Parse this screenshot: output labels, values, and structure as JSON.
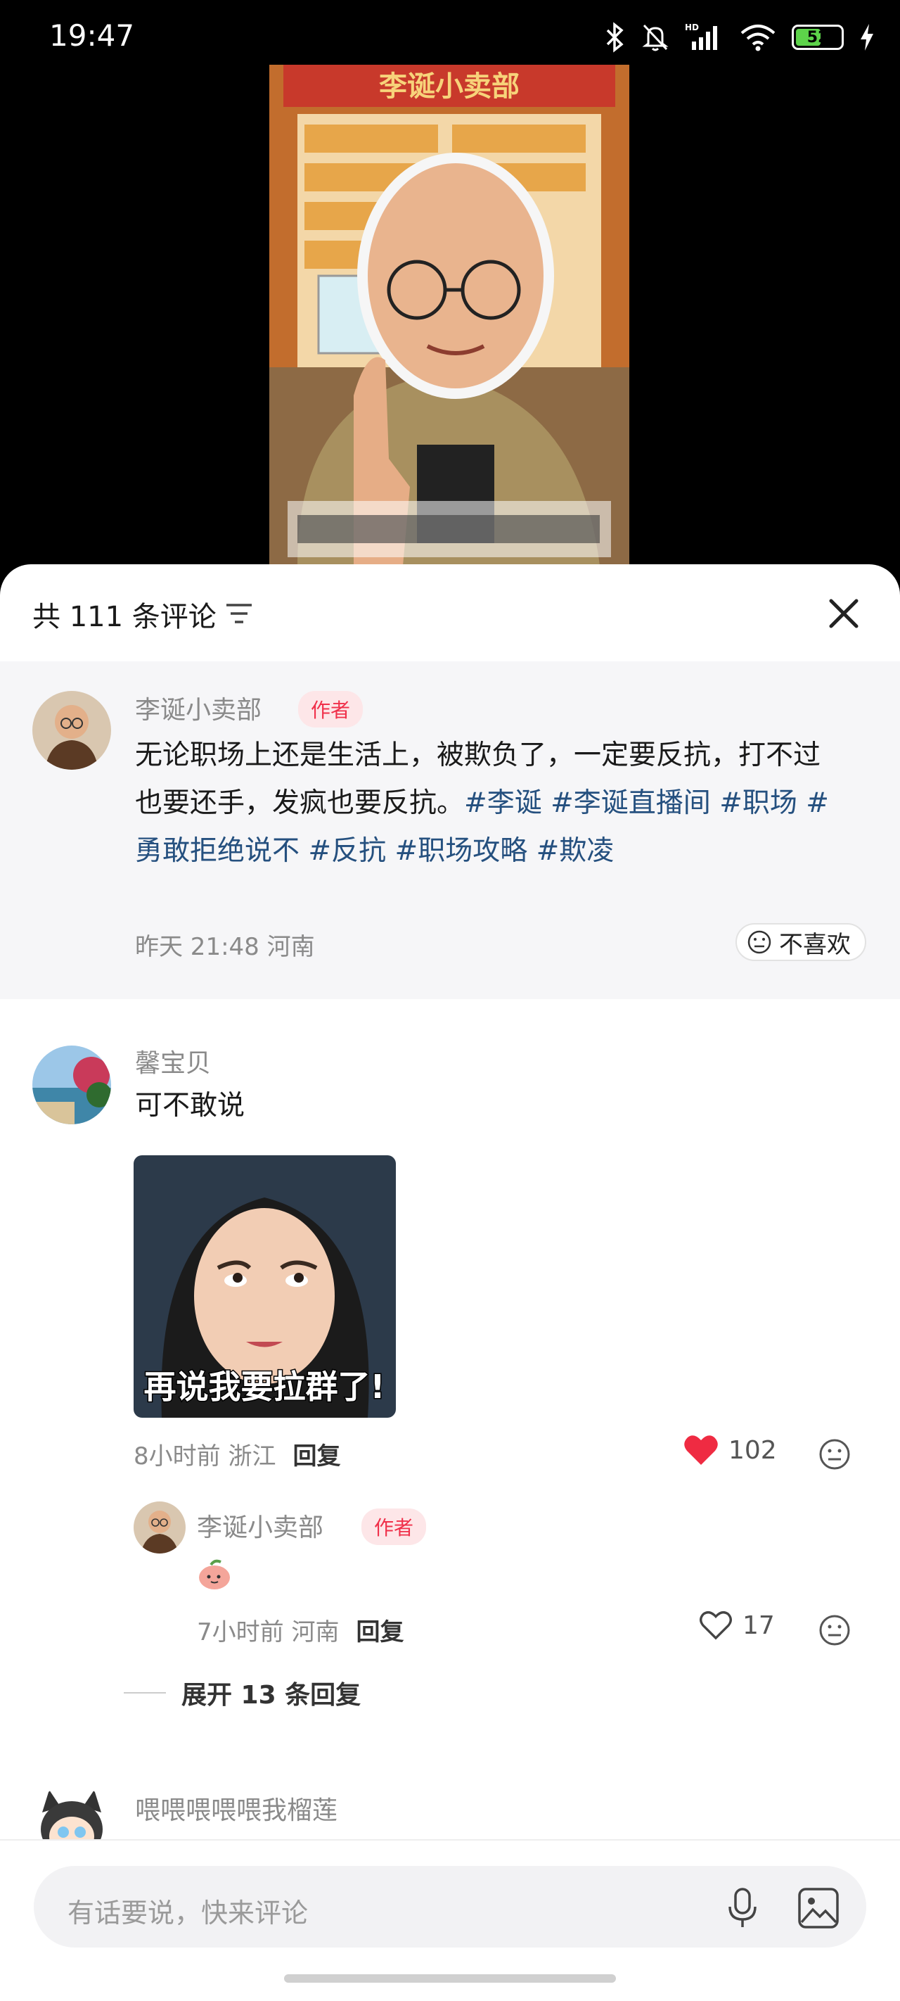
{
  "status_bar": {
    "time": "19:47",
    "battery": "52",
    "icons": [
      "bluetooth-icon",
      "mute-bell-icon",
      "signal-hd-icon",
      "wifi-icon",
      "battery-icon",
      "charging-icon"
    ]
  },
  "video": {
    "sign_text": "李诞小卖部",
    "subtitle_text": "(blurred subtitle)"
  },
  "comments_panel": {
    "count_label": "共 111 条评论",
    "pinned": {
      "author": "李诞小卖部",
      "badge": "作者",
      "text_plain": "无论职场上还是生活上，被欺负了，一定要反抗，打不过也要还手，发疯也要反抗。",
      "tags": [
        "#李诞",
        "#李诞直播间",
        "#职场",
        "#勇敢拒绝说不",
        "#反抗",
        "#职场攻略",
        "#欺凌"
      ],
      "time_location": "昨天 21:48 河南",
      "dislike_label": "不喜欢"
    },
    "comment1": {
      "author": "馨宝贝",
      "text": "可不敢说",
      "meme_caption": "再说我要拉群了!",
      "time_location": "8小时前 浙江",
      "reply_label": "回复",
      "likes": "102",
      "reply": {
        "author": "李诞小卖部",
        "badge": "作者",
        "time_location": "7小时前 河南",
        "reply_label": "回复",
        "likes": "17"
      },
      "expand_label": "展开 13 条回复"
    },
    "comment2": {
      "author": "喂喂喂喂喂我榴莲"
    },
    "input_placeholder": "有话要说，快来评论"
  },
  "colors": {
    "accent_red": "#f0304a",
    "tag_blue": "#25507f",
    "like_red": "#ef2b42"
  }
}
